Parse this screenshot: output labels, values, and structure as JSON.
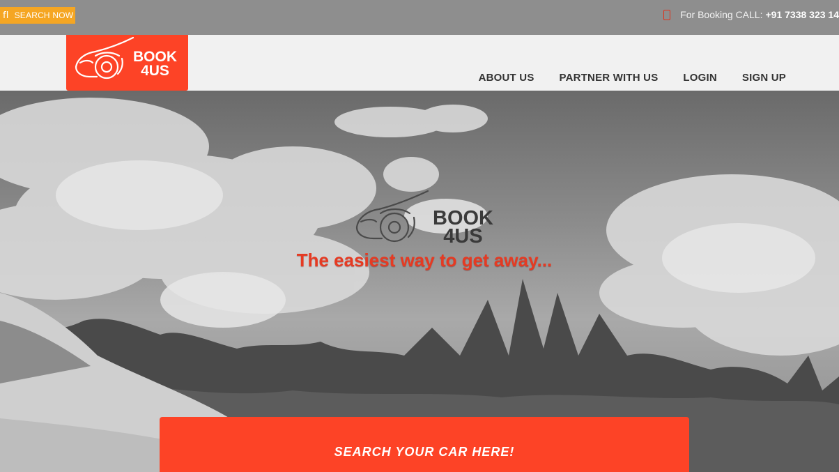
{
  "topbar": {
    "search_now_glyph": "fl",
    "search_now_label": "SEARCH NOW",
    "booking_label": "For Booking CALL:",
    "booking_phone": "+91 7338 323 14"
  },
  "logo": {
    "line1": "BOOK",
    "line2": "4US"
  },
  "nav": {
    "items": [
      {
        "label": "ABOUT US"
      },
      {
        "label": "PARTNER WITH US"
      },
      {
        "label": "LOGIN"
      },
      {
        "label": "SIGN UP"
      }
    ]
  },
  "hero": {
    "logo_line1": "BOOK",
    "logo_line2": "4US",
    "tagline": "The easiest way to get away...",
    "search_panel_title": "SEARCH YOUR CAR HERE!"
  },
  "colors": {
    "brand": "#fd4326",
    "accent_orange": "#f5a623",
    "tagline_red": "#e63a22"
  }
}
